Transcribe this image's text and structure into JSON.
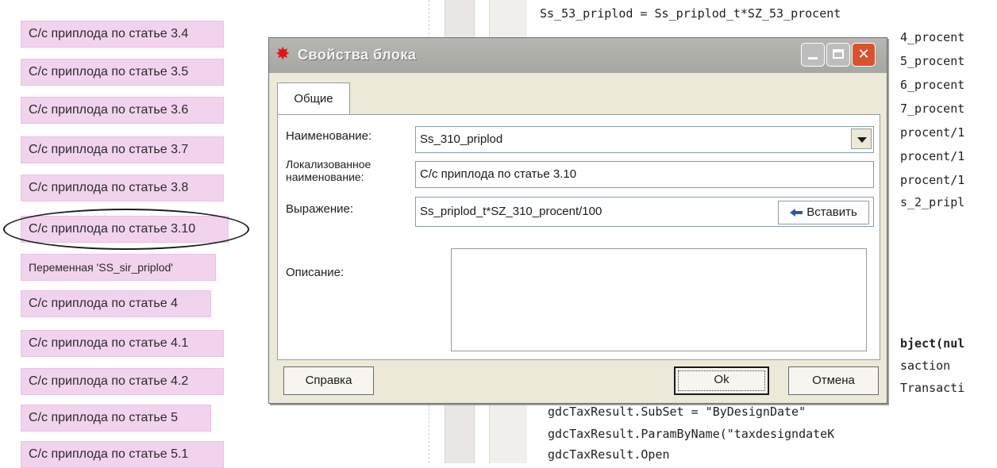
{
  "left_blocks": [
    "С/с приплода по статье 3.4",
    "С/с приплода по статье 3.5",
    "С/с приплода по статье 3.6",
    "С/с приплода по статье 3.7",
    "С/с приплода по статье 3.8",
    "С/с приплода по статье 3.10",
    "Переменная 'SS_sir_priplod'",
    "С/с приплода по статье 4",
    "С/с приплода по статье 4.1",
    "С/с приплода по статье 4.2",
    "С/с приплода по статье 5",
    "С/с приплода по статье 5.1"
  ],
  "code_lines": [
    "Ss_53_priplod = Ss_priplod_t*SZ_53_procent",
    "4_procent",
    "5_procent",
    "6_procent",
    "7_procent",
    "procent/1",
    "procent/1",
    "procent/1",
    "s_2_pripl",
    "bject(nul",
    "saction",
    "Transacti",
    "gdcTaxResult.SubSet = \"ByDesignDate\"",
    "gdcTaxResult.ParamByName(\"taxdesigndateK",
    "gdcTaxResult.Open"
  ],
  "dialog": {
    "title": "Свойства блока",
    "tab_general": "Общие",
    "label_name": "Наименование:",
    "label_localized_1": "Локализованное",
    "label_localized_2": "наименование:",
    "label_expression": "Выражение:",
    "label_description": "Описание:",
    "name_value": "Ss_310_priplod",
    "localized_value": "С/с приплода по статье 3.10",
    "expression_value": "Ss_priplod_t*SZ_310_procent/100",
    "description_value": "",
    "insert_button": "Вставить",
    "help_button": "Справка",
    "ok_button": "Ok",
    "cancel_button": "Отмена"
  },
  "icons": {
    "dialog_icon": "star-burst-icon",
    "insert_icon": "arrow-left-icon",
    "dropdown_icon": "chevron-down-icon"
  },
  "colors": {
    "block_fill": "#f2d3ee",
    "dialog_bg": "#ece9d8",
    "close_button": "#d8532d",
    "title_text": "#f4f4f4"
  }
}
